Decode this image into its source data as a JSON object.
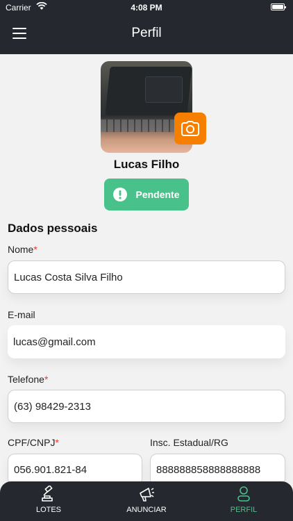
{
  "status_bar": {
    "carrier": "Carrier",
    "time": "4:08 PM"
  },
  "header": {
    "title": "Perfil"
  },
  "profile": {
    "name": "Lucas Filho",
    "status": "Pendente"
  },
  "section": {
    "title": "Dados pessoais"
  },
  "form": {
    "nome": {
      "label": "Nome",
      "required": "*",
      "value": "Lucas Costa Silva Filho"
    },
    "email": {
      "label": "E-mail",
      "value": "lucas@gmail.com"
    },
    "telefone": {
      "label": "Telefone",
      "required": "*",
      "value": "(63) 98429-2313"
    },
    "cpf": {
      "label": "CPF/CNPJ",
      "required": "*",
      "value": "056.901.821-84"
    },
    "inscricao": {
      "label": "Insc. Estadual/RG",
      "value": "888888858888888888"
    }
  },
  "tabs": [
    {
      "label": "LOTES",
      "icon": "gavel-icon"
    },
    {
      "label": "ANUNCIAR",
      "icon": "megaphone-icon"
    },
    {
      "label": "PERFIL",
      "icon": "user-icon"
    }
  ],
  "colors": {
    "header": "#262830",
    "accent_orange": "#f77f00",
    "status_green": "#48c28a"
  }
}
